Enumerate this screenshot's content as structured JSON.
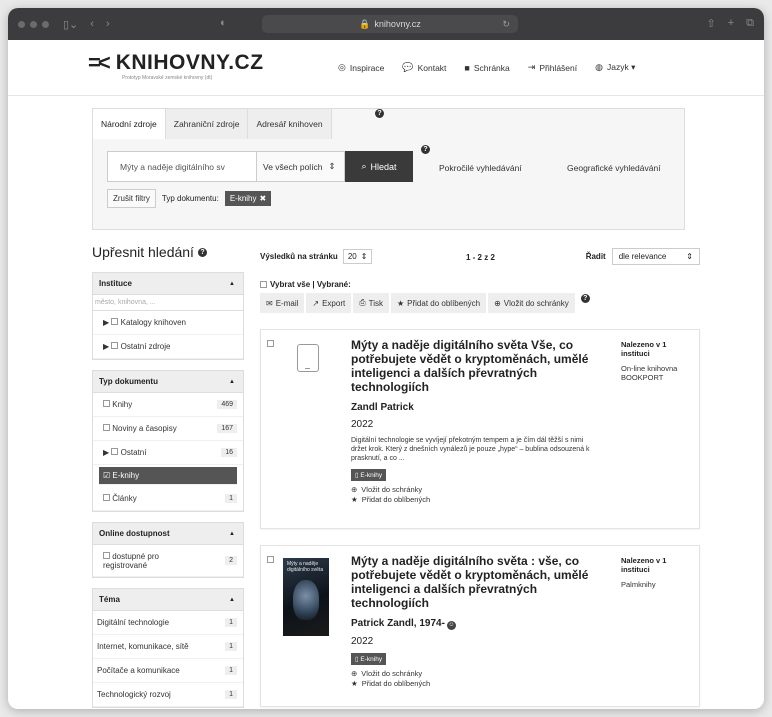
{
  "browser": {
    "url": "knihovny.cz",
    "lock_icon": "lock-icon"
  },
  "header": {
    "logo_text": "KNIHOVNY.CZ",
    "logo_subtitle": "Prototyp Moravské zemské knihovny (dt)",
    "nav": [
      {
        "label": "Inspirace",
        "icon": "inspiration-icon"
      },
      {
        "label": "Kontakt",
        "icon": "chat-icon"
      },
      {
        "label": "Schránka",
        "icon": "briefcase-icon"
      },
      {
        "label": "Přihlášení",
        "icon": "login-icon"
      },
      {
        "label": "Jazyk ▾",
        "icon": "globe-icon"
      }
    ]
  },
  "search": {
    "tabs": [
      "Národní zdroje",
      "Zahraniční zdroje",
      "Adresář knihoven"
    ],
    "query": "Mýty a naděje digitálního sv",
    "scope": "Ve všech polích",
    "search_button": "Hledat",
    "advanced": "Pokročilé vyhledávání",
    "geo": "Geografické vyhledávání",
    "clear_filters": "Zrušit filtry",
    "doc_type_label": "Typ dokumentu:",
    "doc_type_chip": "E-knihy"
  },
  "facets": {
    "title": "Upřesnit hledání",
    "instituce": {
      "head": "Instituce",
      "filter_placeholder": "město, knihovna, ...",
      "items": [
        "Katalogy knihoven",
        "Ostatní zdroje"
      ]
    },
    "typ": {
      "head": "Typ dokumentu",
      "items": [
        {
          "label": "Knihy",
          "count": "469"
        },
        {
          "label": "Noviny a časopisy",
          "count": "167"
        },
        {
          "label": "Ostatní",
          "count": "16"
        },
        {
          "label": "E-knihy",
          "count": ""
        },
        {
          "label": "Články",
          "count": "1"
        }
      ]
    },
    "online": {
      "head": "Online dostupnost",
      "items": [
        {
          "label": "dostupné pro registrované",
          "count": "2"
        }
      ]
    },
    "tema": {
      "head": "Téma",
      "items": [
        {
          "label": "Digitální technologie",
          "count": "1"
        },
        {
          "label": "Internet, komunikace, sítě",
          "count": "1"
        },
        {
          "label": "Počítače a komunikace",
          "count": "1"
        },
        {
          "label": "Technologický rozvoj",
          "count": "1"
        }
      ]
    }
  },
  "results": {
    "per_page_label": "Výsledků na stránku",
    "per_page": "20",
    "pager": "1 - 2 z 2",
    "sort_label": "Řadit",
    "sort_value": "dle relevance",
    "select_all": "Vybrat vše | Vybrané:",
    "actions": [
      {
        "label": "E-mail",
        "icon": "email-icon"
      },
      {
        "label": "Export",
        "icon": "export-icon"
      },
      {
        "label": "Tisk",
        "icon": "print-icon"
      },
      {
        "label": "Přidat do oblíbených",
        "icon": "star-icon"
      },
      {
        "label": "Vložit do schránky",
        "icon": "plus-circle-icon"
      }
    ],
    "items": [
      {
        "title": "Mýty a naděje digitálního světa Vše, co potřebujete vědět o kryptoměnách, umělé inteligenci a dalších převratných technologiích",
        "author": "Zandl Patrick",
        "year": "2022",
        "description": "Digitální technologie se vyvíjejí překotným tempem a je čím dál těžší s nimi držet krok. Který z dnešních vynálezů je pouze „hype“ – bublina odsouzená k prasknutí, a co ...",
        "badge": "E-knihy",
        "link1": "Vložit do schránky",
        "link2": "Přidat do oblíbených",
        "found": "Nalezeno v 1 instituci",
        "source": "On-line knihovna BOOKPORT"
      },
      {
        "title": "Mýty a naděje digitálního světa : vše, co potřebujete vědět o kryptoměnách, umělé inteligenci a dalších převratných technologiích",
        "author": "Patrick Zandl, 1974-",
        "year": "2022",
        "badge": "E-knihy",
        "link1": "Vložit do schránky",
        "link2": "Přidat do oblíbených",
        "found": "Nalezeno v 1 instituci",
        "source": "Palmknihy",
        "cover_title": "Mýty a naděje digitálního světa"
      }
    ]
  }
}
